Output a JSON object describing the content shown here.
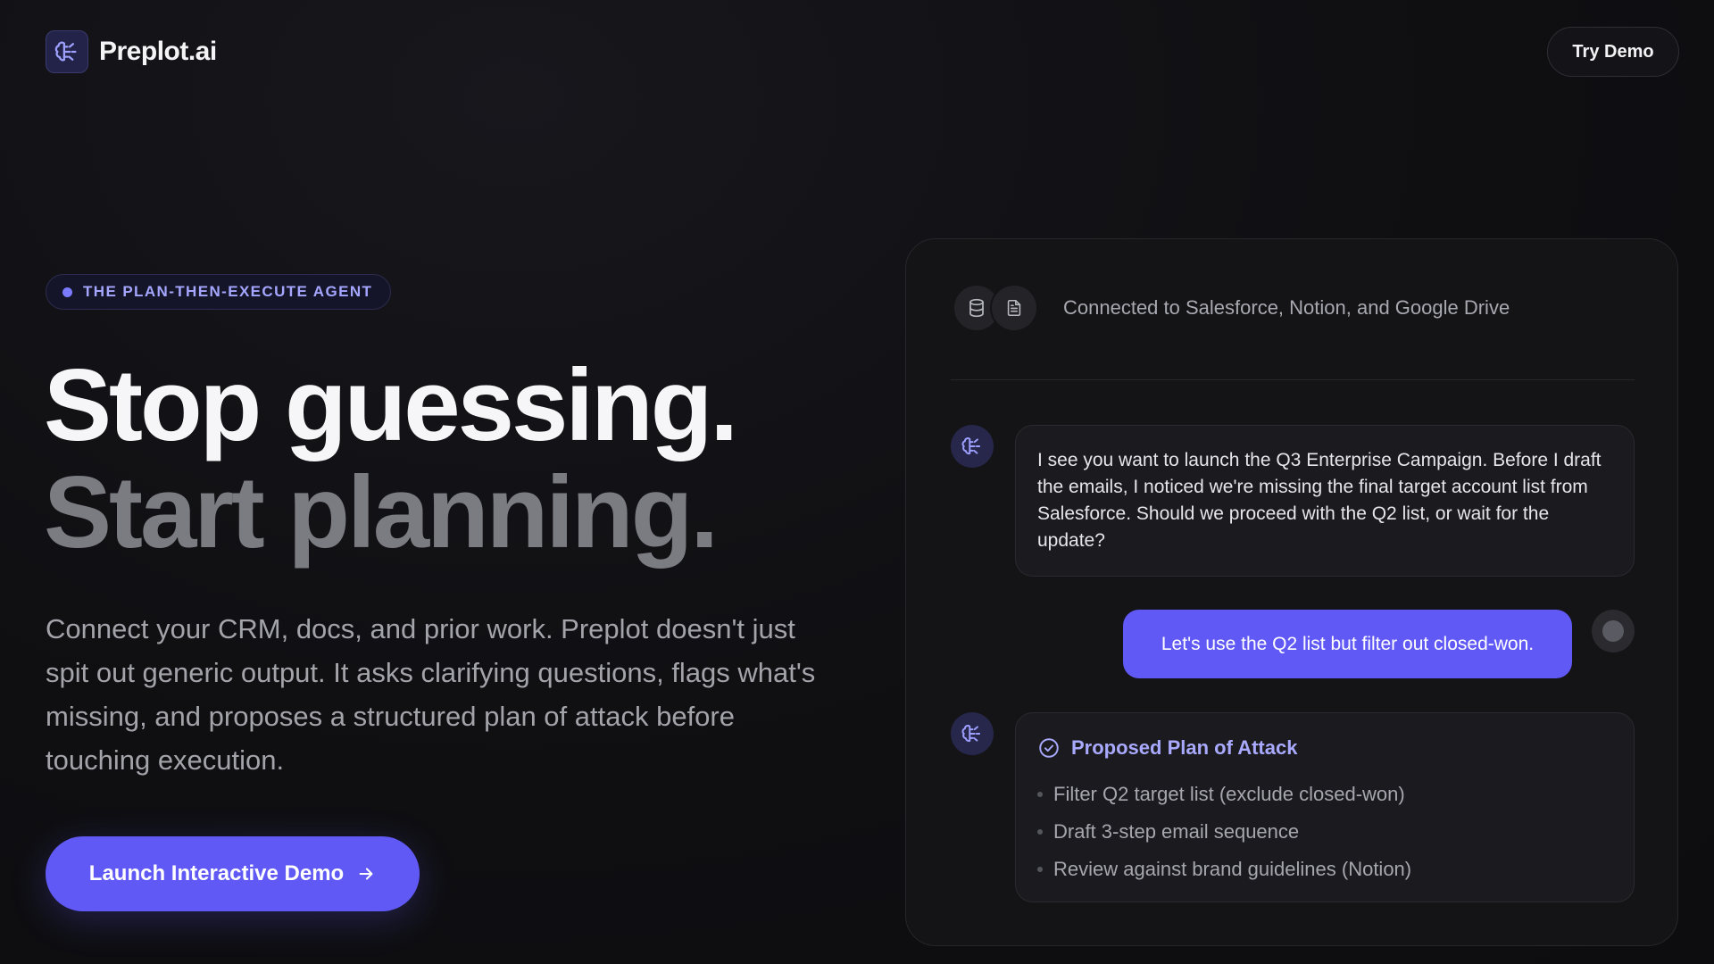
{
  "nav": {
    "brand": "Preplot.ai",
    "logo_icon": "brain-icon",
    "try_demo_label": "Try Demo"
  },
  "hero": {
    "badge": "THE PLAN-THEN-EXECUTE AGENT",
    "headline_line1": "Stop guessing.",
    "headline_line2": "Start planning.",
    "description": "Connect your CRM, docs, and prior work. Preplot doesn't just spit out generic output. It asks clarifying questions, flags what's missing, and proposes a structured plan of attack before touching execution.",
    "cta_label": "Launch Interactive Demo",
    "cta_icon": "arrow-right-icon"
  },
  "chat": {
    "connected_icons": [
      "database-icon",
      "document-icon"
    ],
    "connected_text": "Connected to Salesforce, Notion, and Google Drive",
    "assistant_message": "I see you want to launch the Q3 Enterprise Campaign. Before I draft the emails, I noticed we're missing the final target account list from Salesforce. Should we proceed with the Q2 list, or wait for the update?",
    "user_message": "Let's use the Q2 list but filter out closed-won.",
    "plan": {
      "title": "Proposed Plan of Attack",
      "icon": "check-circle-icon",
      "items": [
        "Filter Q2 target list (exclude closed-won)",
        "Draft 3-step email sequence",
        "Review against brand guidelines (Notion)"
      ]
    }
  },
  "colors": {
    "accent": "#6059f5",
    "accent_text": "#a9aaff",
    "background": "#0f0f12",
    "panel": "#141417"
  }
}
